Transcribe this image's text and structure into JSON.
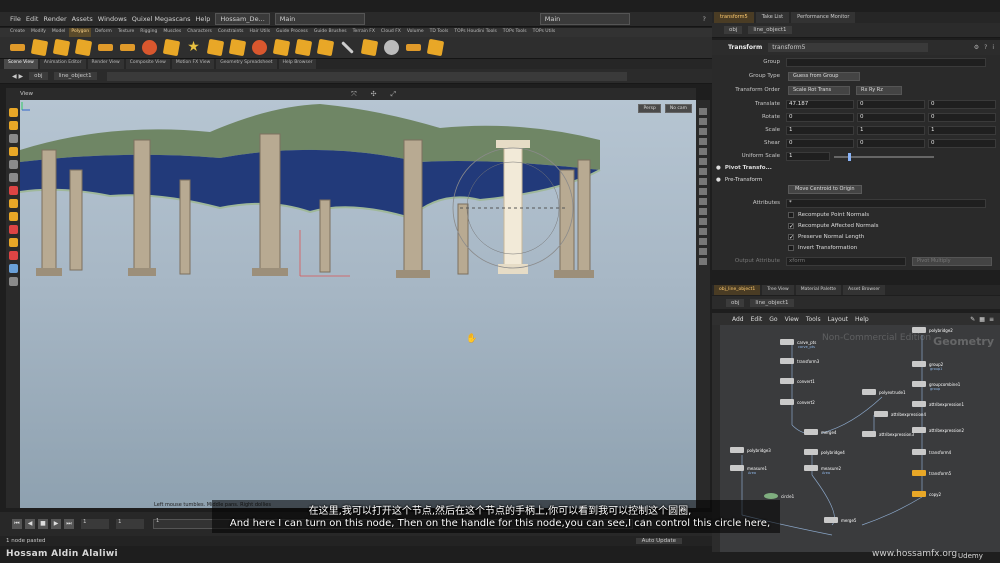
{
  "menubar": {
    "items": [
      "File",
      "Edit",
      "Render",
      "Assets",
      "Windows",
      "Quixel Megascans",
      "Help"
    ],
    "desktop": "Hossam_De...",
    "workspace": "Main",
    "right_workspace": "Main"
  },
  "shelf": {
    "tabs": [
      "Create",
      "Modify",
      "Model",
      "Polygon",
      "Deform",
      "Texture",
      "Rigging",
      "Muscles",
      "Characters",
      "Constraints",
      "Hair Utils",
      "Guide Process",
      "Guide Brushes",
      "Terrain FX",
      "Cloud FX",
      "Volume",
      "TD Tools",
      "TOPs Houdini Tools",
      "TOPs Tools",
      "TOPs Utils"
    ],
    "active_tab": "Polygon"
  },
  "viewer": {
    "tabs": [
      "Scene View",
      "Animation Editor",
      "Render View",
      "Composite View",
      "Motion FX View",
      "Geometry Spreadsheet",
      "Help Browser"
    ],
    "path_root": "obj",
    "path_object": "line_object1",
    "view_label": "View",
    "persp": "Persp",
    "cam": "No cam",
    "hint": "Left mouse tumbles. Middle pans. Right dollies"
  },
  "timeline": {
    "frame": "1",
    "start": "1",
    "end": "1",
    "tick": "1"
  },
  "status": {
    "message": "1 node pasted",
    "auto_update": "Auto Update"
  },
  "param_panel": {
    "tabs": [
      "transform5",
      "Take List",
      "Performance Monitor"
    ],
    "node_type": "Transform",
    "node_name": "transform5",
    "group_label": "Group",
    "group_value": "",
    "group_type_label": "Group Type",
    "group_type_value": "Guess from Group",
    "transform_order_label": "Transform Order",
    "transform_order_value": "Scale Rot Trans",
    "rot_order_value": "Rx Ry Rz",
    "translate_label": "Translate",
    "translate": [
      "47.187",
      "0",
      "0"
    ],
    "rotate_label": "Rotate",
    "rotate": [
      "0",
      "0",
      "0"
    ],
    "scale_label": "Scale",
    "scale": [
      "1",
      "1",
      "1"
    ],
    "shear_label": "Shear",
    "shear": [
      "0",
      "0",
      "0"
    ],
    "uniform_scale_label": "Uniform Scale",
    "uniform_scale": "1",
    "pivot_transform": "Pivot Transfo...",
    "pre_transform": "Pre-Transform",
    "move_centroid": "Move Centroid to Origin",
    "attributes_label": "Attributes",
    "attributes_value": "*",
    "recompute_point_normals": "Recompute Point Normals",
    "recompute_affected_normals": "Recompute Affected Normals",
    "preserve_normal_length": "Preserve Normal Length",
    "invert_transformation": "Invert Transformation",
    "output_attribute_label": "Output Attribute",
    "output_attribute_value": "xform",
    "pivot_multiply": "Pivot Multiply"
  },
  "network": {
    "tabs": [
      "obj_line_object1",
      "Tree View",
      "Material Palette",
      "Asset Browser"
    ],
    "path_root": "obj",
    "path_object": "line_object1",
    "menu": [
      "Add",
      "Edit",
      "Go",
      "View",
      "Tools",
      "Layout",
      "Help"
    ],
    "watermark": "Non-Commercial Edition",
    "context": "Geometry",
    "nodes": [
      {
        "label": "carve_pts",
        "sub": "carve_pts"
      },
      {
        "label": "transform3",
        "sub": ""
      },
      {
        "label": "convert1",
        "sub": ""
      },
      {
        "label": "convert2",
        "sub": ""
      },
      {
        "label": "merge4",
        "sub": ""
      },
      {
        "label": "polybridge3",
        "sub": ""
      },
      {
        "label": "polybridge4",
        "sub": ""
      },
      {
        "label": "measure1",
        "sub": "Area"
      },
      {
        "label": "measure2",
        "sub": "Area"
      },
      {
        "label": "attribexpression3",
        "sub": ""
      },
      {
        "label": "merge5",
        "sub": ""
      },
      {
        "label": "polybridge2",
        "sub": ""
      },
      {
        "label": "group2",
        "sub": "group1"
      },
      {
        "label": "groupcombine1",
        "sub": "group"
      },
      {
        "label": "attribexpression1",
        "sub": ""
      },
      {
        "label": "attribexpression2",
        "sub": ""
      },
      {
        "label": "transform4",
        "sub": ""
      },
      {
        "label": "transform5",
        "sub": ""
      },
      {
        "label": "copy2",
        "sub": ""
      },
      {
        "label": "polyextrude1",
        "sub": ""
      },
      {
        "label": "attribexpression4",
        "sub": ""
      },
      {
        "label": "circle1",
        "sub": ""
      }
    ]
  },
  "subtitles": {
    "chinese": "在这里,我可以打开这个节点,然后在这个节点的手柄上,你可以看到我可以控制这个圆圈,",
    "english": "And here I can turn on this node, Then on the handle for this node,you can see,I can control this circle here,"
  },
  "branding": {
    "author": "Hossam Aldin Alaliwi",
    "site": "www.hossamfx.org",
    "platform": "Udemy"
  }
}
